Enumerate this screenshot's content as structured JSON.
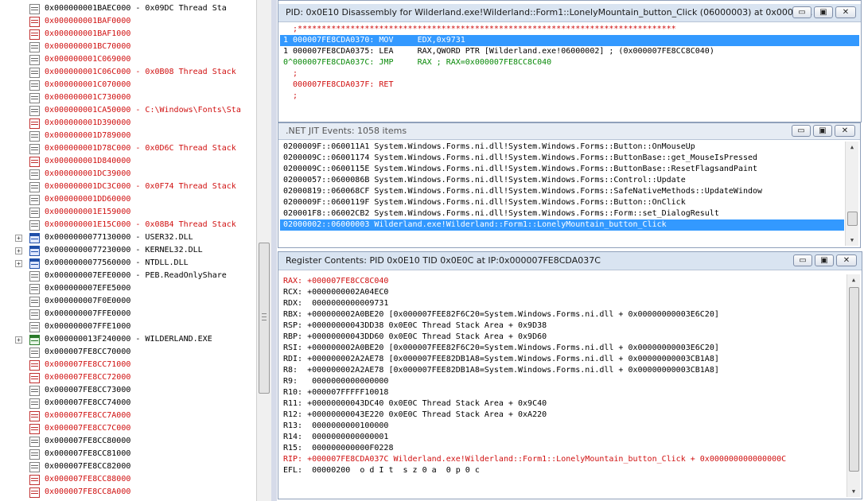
{
  "tree": {
    "rows": [
      {
        "addr": "0x000000001BAEC000",
        "label": " - 0x09DC Thread Sta",
        "red": false,
        "icon": "page"
      },
      {
        "addr": "0x000000001BAF0000",
        "label": "",
        "red": true,
        "icon": "page-red"
      },
      {
        "addr": "0x000000001BAF1000",
        "label": "",
        "red": true,
        "icon": "page-red"
      },
      {
        "addr": "0x000000001BC70000",
        "label": "",
        "red": true,
        "icon": "page"
      },
      {
        "addr": "0x000000001C069000",
        "label": "",
        "red": true,
        "icon": "page"
      },
      {
        "addr": "0x000000001C06C000",
        "label": " - 0x0B08 Thread Stack",
        "red": true,
        "icon": "page"
      },
      {
        "addr": "0x000000001C070000",
        "label": "",
        "red": true,
        "icon": "page"
      },
      {
        "addr": "0x000000001C730000",
        "label": "",
        "red": true,
        "icon": "page"
      },
      {
        "addr": "0x000000001CA50000",
        "label": " - C:\\Windows\\Fonts\\Sta",
        "red": true,
        "icon": "page"
      },
      {
        "addr": "0x000000001D390000",
        "label": "",
        "red": true,
        "icon": "page-red"
      },
      {
        "addr": "0x000000001D789000",
        "label": "",
        "red": true,
        "icon": "page"
      },
      {
        "addr": "0x000000001D78C000",
        "label": " - 0x0D6C Thread Stack",
        "red": true,
        "icon": "page"
      },
      {
        "addr": "0x000000001D840000",
        "label": "",
        "red": true,
        "icon": "page-red"
      },
      {
        "addr": "0x000000001DC39000",
        "label": "",
        "red": true,
        "icon": "page"
      },
      {
        "addr": "0x000000001DC3C000",
        "label": " - 0x0F74 Thread Stack",
        "red": true,
        "icon": "page"
      },
      {
        "addr": "0x000000001DD60000",
        "label": "",
        "red": true,
        "icon": "page"
      },
      {
        "addr": "0x000000001E159000",
        "label": "",
        "red": true,
        "icon": "page"
      },
      {
        "addr": "0x000000001E15C000",
        "label": " - 0x08B4 Thread Stack",
        "red": true,
        "icon": "page"
      },
      {
        "addr": "0x0000000077130000",
        "label": " - USER32.DLL",
        "red": false,
        "icon": "module",
        "expand": true
      },
      {
        "addr": "0x0000000077230000",
        "label": " - KERNEL32.DLL",
        "red": false,
        "icon": "module",
        "expand": true
      },
      {
        "addr": "0x0000000077560000",
        "label": " - NTDLL.DLL",
        "red": false,
        "icon": "module",
        "expand": true
      },
      {
        "addr": "0x000000007EFE0000",
        "label": " - PEB.ReadOnlyShare",
        "red": false,
        "icon": "page"
      },
      {
        "addr": "0x000000007EFE5000",
        "label": "",
        "red": false,
        "icon": "page"
      },
      {
        "addr": "0x000000007F0E0000",
        "label": "",
        "red": false,
        "icon": "page"
      },
      {
        "addr": "0x000000007FFE0000",
        "label": "",
        "red": false,
        "icon": "page"
      },
      {
        "addr": "0x000000007FFE1000",
        "label": "",
        "red": false,
        "icon": "page"
      },
      {
        "addr": "0x000000013F240000",
        "label": " - WILDERLAND.EXE",
        "red": false,
        "icon": "exe",
        "expand": true
      },
      {
        "addr": "0x000007FE8CC70000",
        "label": "",
        "red": false,
        "icon": "page"
      },
      {
        "addr": "0x000007FE8CC71000",
        "label": "",
        "red": true,
        "icon": "page-red"
      },
      {
        "addr": "0x000007FE8CC72000",
        "label": "",
        "red": true,
        "icon": "page-red"
      },
      {
        "addr": "0x000007FE8CC73000",
        "label": "",
        "red": false,
        "icon": "page"
      },
      {
        "addr": "0x000007FE8CC74000",
        "label": "",
        "red": false,
        "icon": "page"
      },
      {
        "addr": "0x000007FE8CC7A000",
        "label": "",
        "red": true,
        "icon": "page-red"
      },
      {
        "addr": "0x000007FE8CC7C000",
        "label": "",
        "red": true,
        "icon": "page-red"
      },
      {
        "addr": "0x000007FE8CC80000",
        "label": "",
        "red": false,
        "icon": "page"
      },
      {
        "addr": "0x000007FE8CC81000",
        "label": "",
        "red": false,
        "icon": "page"
      },
      {
        "addr": "0x000007FE8CC82000",
        "label": "",
        "red": false,
        "icon": "page"
      },
      {
        "addr": "0x000007FE8CC88000",
        "label": "",
        "red": true,
        "icon": "page-red"
      },
      {
        "addr": "0x000007FE8CC8A000",
        "label": "",
        "red": true,
        "icon": "page-red"
      }
    ]
  },
  "disasm": {
    "title": "PID: 0x0E10 Disassembly for Wilderland.exe!Wilderland::Form1::LonelyMountain_button_Click (06000003) at 0x00000...",
    "lines": [
      {
        "text": "  ;*******************************************************************************",
        "style": "red"
      },
      {
        "text": "1 000007FE8CDA0370: MOV     EDX,0x9731",
        "style": "sel"
      },
      {
        "text": "1 000007FE8CDA0375: LEA     RAX,QWORD PTR [Wilderland.exe!06000002] ; (0x000007FE8CC8C040)",
        "style": "normal"
      },
      {
        "text": "0^000007FE8CDA037C: JMP     RAX ; RAX=0x000007FE8CC8C040",
        "style": "green"
      },
      {
        "text": "  ;",
        "style": "red"
      },
      {
        "text": "  000007FE8CDA037F: RET",
        "style": "red"
      },
      {
        "text": "  ;",
        "style": "red"
      }
    ]
  },
  "jit": {
    "title": ".NET JIT Events: 1058 items",
    "lines": [
      {
        "text": "0200009F::060011A1 System.Windows.Forms.ni.dll!System.Windows.Forms::Button::OnMouseUp",
        "style": "normal"
      },
      {
        "text": "0200009C::06001174 System.Windows.Forms.ni.dll!System.Windows.Forms::ButtonBase::get_MouseIsPressed",
        "style": "normal"
      },
      {
        "text": "0200009C::0600115E System.Windows.Forms.ni.dll!System.Windows.Forms::ButtonBase::ResetFlagsandPaint",
        "style": "normal"
      },
      {
        "text": "02000057::0600086B System.Windows.Forms.ni.dll!System.Windows.Forms::Control::Update",
        "style": "normal"
      },
      {
        "text": "02000819::060068CF System.Windows.Forms.ni.dll!System.Windows.Forms::SafeNativeMethods::UpdateWindow",
        "style": "normal"
      },
      {
        "text": "0200009F::0600119F System.Windows.Forms.ni.dll!System.Windows.Forms::Button::OnClick",
        "style": "normal"
      },
      {
        "text": "020001F8::06002CB2 System.Windows.Forms.ni.dll!System.Windows.Forms::Form::set_DialogResult",
        "style": "normal"
      },
      {
        "text": "02000002::06000003 Wilderland.exe!Wilderland::Form1::LonelyMountain_button_Click",
        "style": "sel"
      }
    ]
  },
  "regs": {
    "title": "Register Contents: PID 0x0E10 TID 0x0E0C at IP:0x000007FE8CDA037C",
    "lines": [
      {
        "text": "RAX: +000007FE8CC8C040",
        "style": "red"
      },
      {
        "text": "RCX: +0000000002A04EC0",
        "style": "normal"
      },
      {
        "text": "RDX:  0000000000009731",
        "style": "normal"
      },
      {
        "text": "RBX: +000000002A0BE20 [0x000007FEE82F6C20=System.Windows.Forms.ni.dll + 0x00000000003E6C20]",
        "style": "normal"
      },
      {
        "text": "RSP: +00000000043DD38 0x0E0C Thread Stack Area + 0x9D38",
        "style": "normal"
      },
      {
        "text": "RBP: +00000000043DD60 0x0E0C Thread Stack Area + 0x9D60",
        "style": "normal"
      },
      {
        "text": "RSI: +000000002A0BE20 [0x000007FEE82F6C20=System.Windows.Forms.ni.dll + 0x00000000003E6C20]",
        "style": "normal"
      },
      {
        "text": "RDI: +000000002A2AE78 [0x000007FEE82DB1A8=System.Windows.Forms.ni.dll + 0x00000000003CB1A8]",
        "style": "normal"
      },
      {
        "text": "R8:  +000000002A2AE78 [0x000007FEE82DB1A8=System.Windows.Forms.ni.dll + 0x00000000003CB1A8]",
        "style": "normal"
      },
      {
        "text": "R9:   0000000000000000",
        "style": "normal"
      },
      {
        "text": "R10: +000007FFFFF10018",
        "style": "normal"
      },
      {
        "text": "R11: +00000000043DC40 0x0E0C Thread Stack Area + 0x9C40",
        "style": "normal"
      },
      {
        "text": "R12: +00000000043E220 0x0E0C Thread Stack Area + 0xA220",
        "style": "normal"
      },
      {
        "text": "R13:  0000000000100000",
        "style": "normal"
      },
      {
        "text": "R14:  0000000000000001",
        "style": "normal"
      },
      {
        "text": "R15:  000000000000F0228",
        "style": "normal"
      },
      {
        "text": "RIP: +000007FE8CDA037C Wilderland.exe!Wilderland::Form1::LonelyMountain_button_Click + 0x000000000000000C",
        "style": "red"
      },
      {
        "text": "EFL:  00000200  o d I t  s z 0 a  0 p 0 c",
        "style": "normal"
      }
    ]
  },
  "controls": {
    "minimize": "▭",
    "restore": "▣",
    "close": "✕"
  }
}
